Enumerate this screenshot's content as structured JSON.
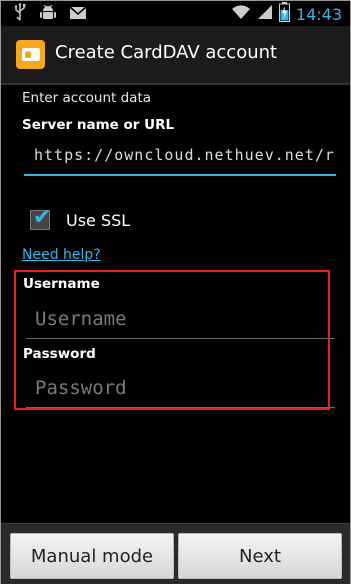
{
  "status_bar": {
    "left_icons": [
      "usb-icon",
      "android-debug-icon",
      "email-icon"
    ],
    "right_icons": [
      "wifi-icon",
      "signal-icon",
      "battery-charging-icon"
    ],
    "time": "14:43",
    "time_color": "#33b5e5"
  },
  "action_bar": {
    "title": "Create CardDAV account",
    "icon": "contact-card-icon",
    "icon_color": "#f3a81e"
  },
  "form": {
    "section_label": "Enter account data",
    "server": {
      "label": "Server name or URL",
      "value": "https://owncloud.nethuev.net/r"
    },
    "ssl": {
      "label": "Use SSL",
      "checked": true
    },
    "help_link": "Need help?",
    "username": {
      "label": "Username",
      "placeholder": "Username"
    },
    "password": {
      "label": "Password",
      "placeholder": "Password"
    },
    "highlight_color": "#e8201c"
  },
  "buttons": {
    "manual_mode": "Manual mode",
    "next": "Next"
  }
}
